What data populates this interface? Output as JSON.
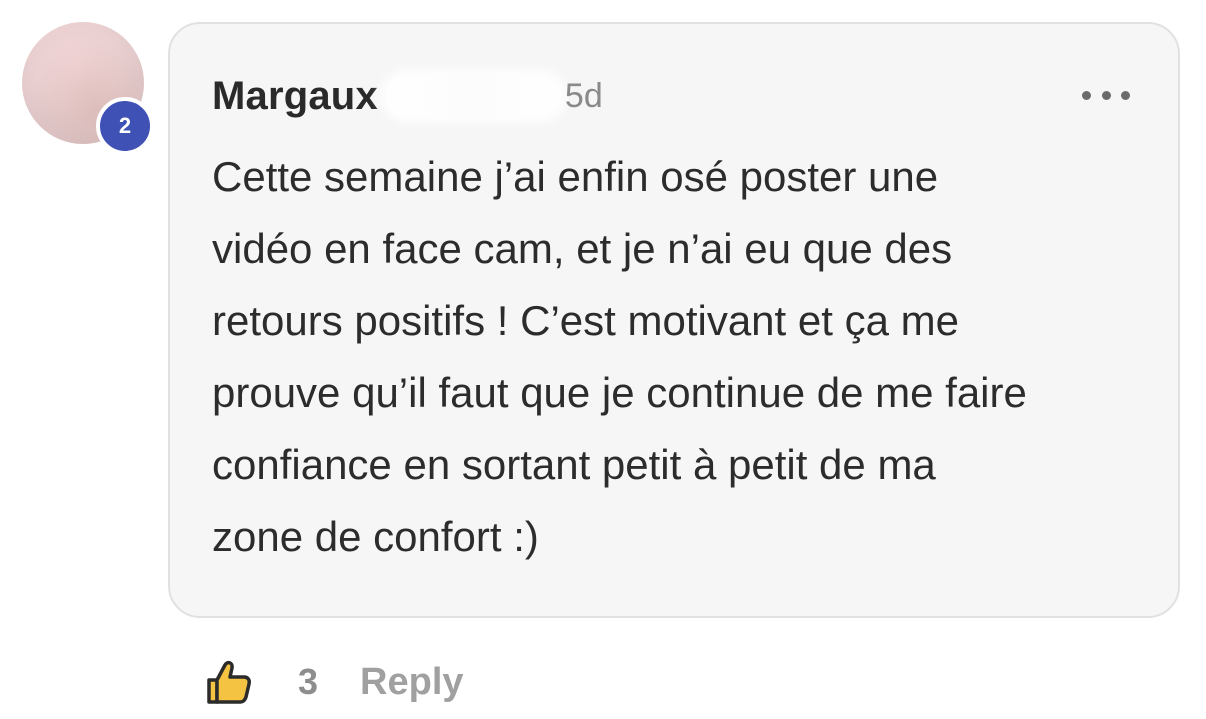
{
  "comment": {
    "author": "Margaux",
    "timestamp": "5d",
    "avatar_badge": "2",
    "text": "Cette semaine j’ai enfin osé poster une\nvidéo en face cam, et je n’ai eu que des\nretours positifs ! C’est motivant et ça me\nprouve qu’il faut que je continue de me faire\nconfiance en sortant petit à petit de ma\nzone de confort :)",
    "more_icon": "more-horizontal-icon"
  },
  "actions": {
    "like_icon": "thumbs-up-icon",
    "like_count": "3",
    "reply_label": "Reply"
  },
  "colors": {
    "badge": "#3f51b5",
    "bubble_background": "#f7f6f6",
    "like_icon_fill": "#f4c342"
  }
}
